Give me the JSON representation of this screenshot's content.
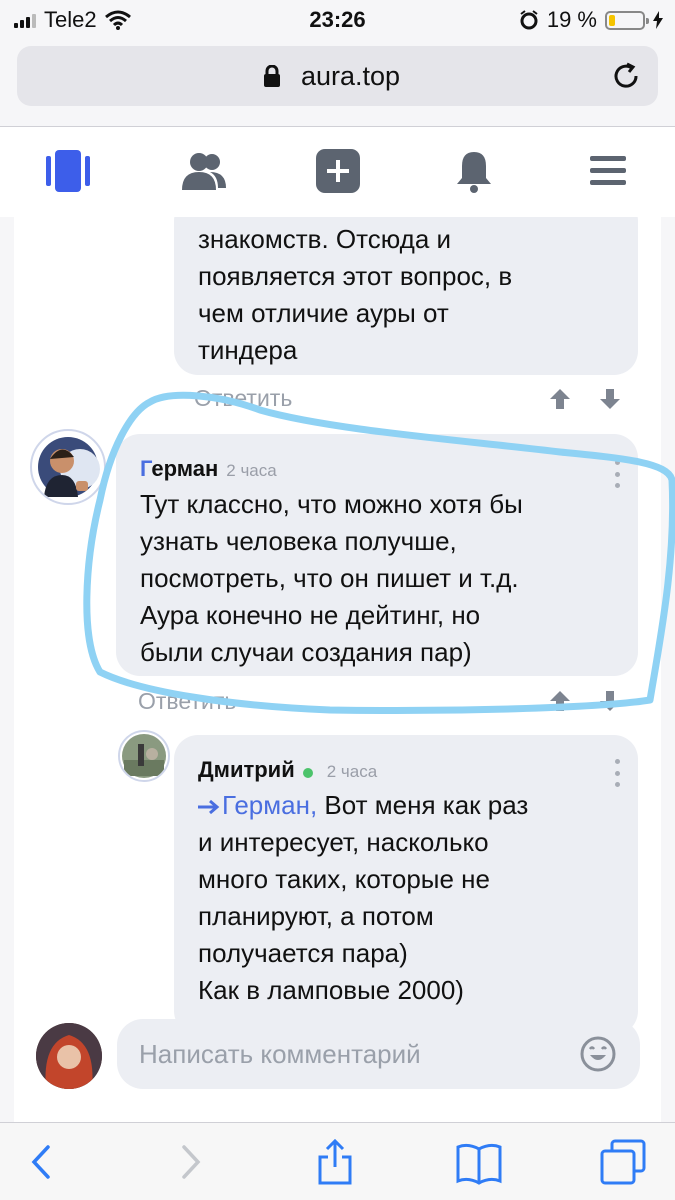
{
  "status_bar": {
    "carrier": "Tele2",
    "time": "23:26",
    "battery_percent": "19 %",
    "battery_level": 0.19
  },
  "browser": {
    "url": "aura.top"
  },
  "nav": {
    "items": [
      "feed-icon",
      "people-icon",
      "add-icon",
      "bell-icon",
      "menu-icon"
    ],
    "active_color": "#3d5eea"
  },
  "comments": [
    {
      "text": "знакомств. Отсюда и\nпоявляется этот вопрос, в\nчем отличие ауры от\nтиндера",
      "reply_label": "Ответить"
    },
    {
      "author": "Герман",
      "time": "2 часа",
      "text": "Тут классно, что можно хотя бы\nузнать человека получше,\nпосмотреть, что он пишет и т.д.\nАура конечно не дейтинг, но\nбыли случаи создания пар)",
      "reply_label": "Ответить"
    },
    {
      "author": "Дмитрий",
      "time": "2 часа",
      "mention": "Герман,",
      "text": " Вот меня как раз\nи интересует, насколько\nмного таких, которые не\nпланируют, а потом\nполучается пара)\nКак в ламповые 2000)"
    }
  ],
  "comment_input": {
    "placeholder": "Написать комментарий"
  },
  "colors": {
    "accent": "#4a6ee0",
    "highlight_stroke": "#8fd2f4",
    "bubble": "#eceef3"
  }
}
